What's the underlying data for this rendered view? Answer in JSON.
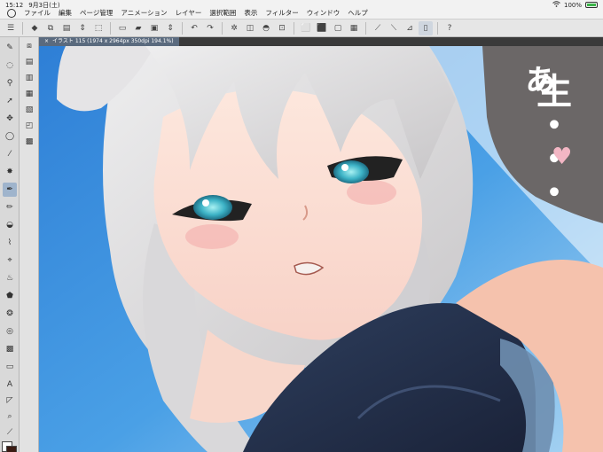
{
  "status": {
    "time": "15:12",
    "date": "9月3日(土)",
    "battery": "100%"
  },
  "menu": {
    "items": [
      "ファイル",
      "編集",
      "ページ管理",
      "アニメーション",
      "レイヤー",
      "選択範囲",
      "表示",
      "フィルター",
      "ウィンドウ",
      "ヘルプ"
    ]
  },
  "document": {
    "tab_label": "イラスト 115 (1974 x 2964px 350dpi 194.1%)",
    "close_glyph": "×"
  },
  "artwork": {
    "speech_text": "生・・・",
    "speech_partial": "ぁ"
  },
  "icons": {
    "app": "clip-studio-icon",
    "wifi": "wifi-icon",
    "battery": "battery-icon"
  },
  "colors": {
    "main_color": "#ffffff",
    "sub_color": "#3a1a12",
    "accent": "#9fb4cc"
  }
}
